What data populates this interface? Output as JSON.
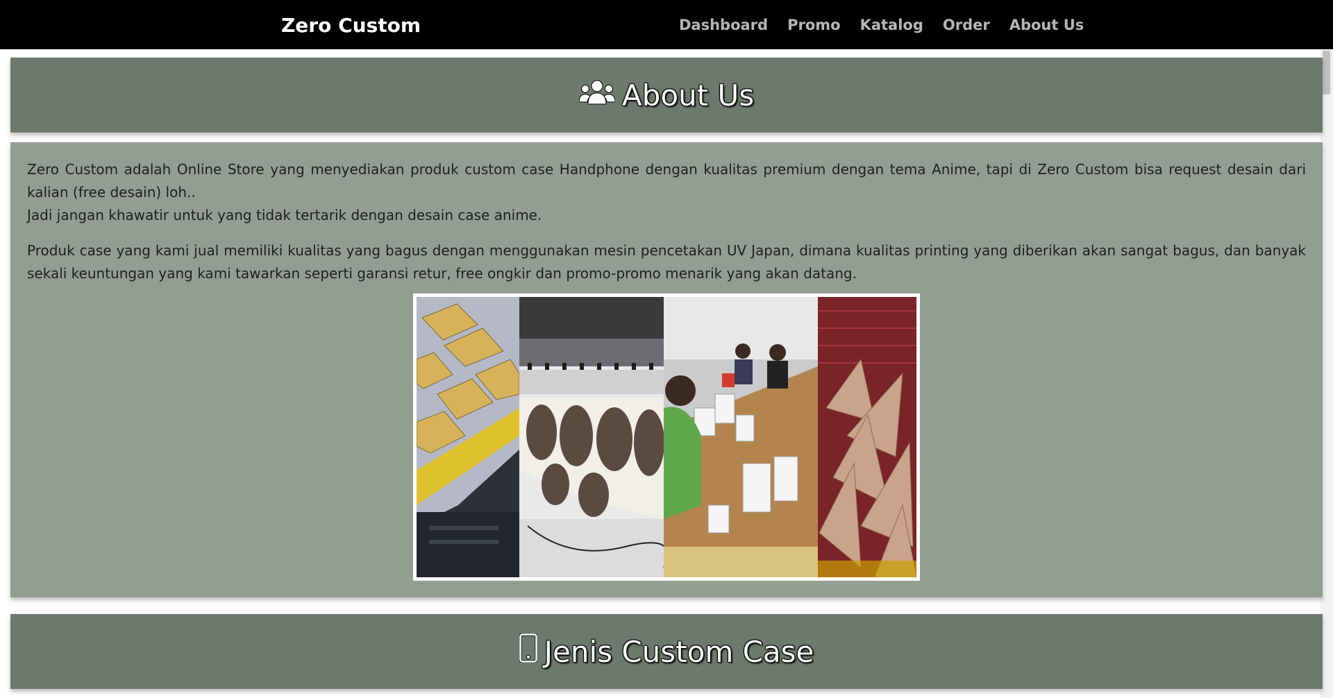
{
  "navbar": {
    "brand": "Zero Custom",
    "links": [
      "Dashboard",
      "Promo",
      "Katalog",
      "Order",
      "About Us"
    ]
  },
  "about": {
    "title": "About Us",
    "paragraph1_line1": "Zero Custom adalah Online Store yang menyediakan produk custom case Handphone dengan kualitas premium dengan tema Anime, tapi di Zero Custom bisa request desain dari kalian (free desain) loh..",
    "paragraph1_line2": "Jadi jangan khawatir untuk yang tidak tertarik dengan desain case anime.",
    "paragraph2": "Produk case yang kami jual memiliki kualitas yang bagus dengan menggunakan mesin pencetakan UV Japan, dimana kualitas printing yang diberikan akan sangat bagus, dan banyak sekali keuntungan yang kami tawarkan seperti garansi retur, free ongkir dan promo-promo menarik yang akan datang."
  },
  "jenis": {
    "title": "Jenis Custom Case"
  },
  "icons": {
    "about": "users-icon",
    "jenis": "mobile-phone-icon"
  },
  "colors": {
    "navbar": "#000000",
    "header": "#6e796e",
    "content": "#939e93",
    "nav_link": "#b7b7b7"
  }
}
